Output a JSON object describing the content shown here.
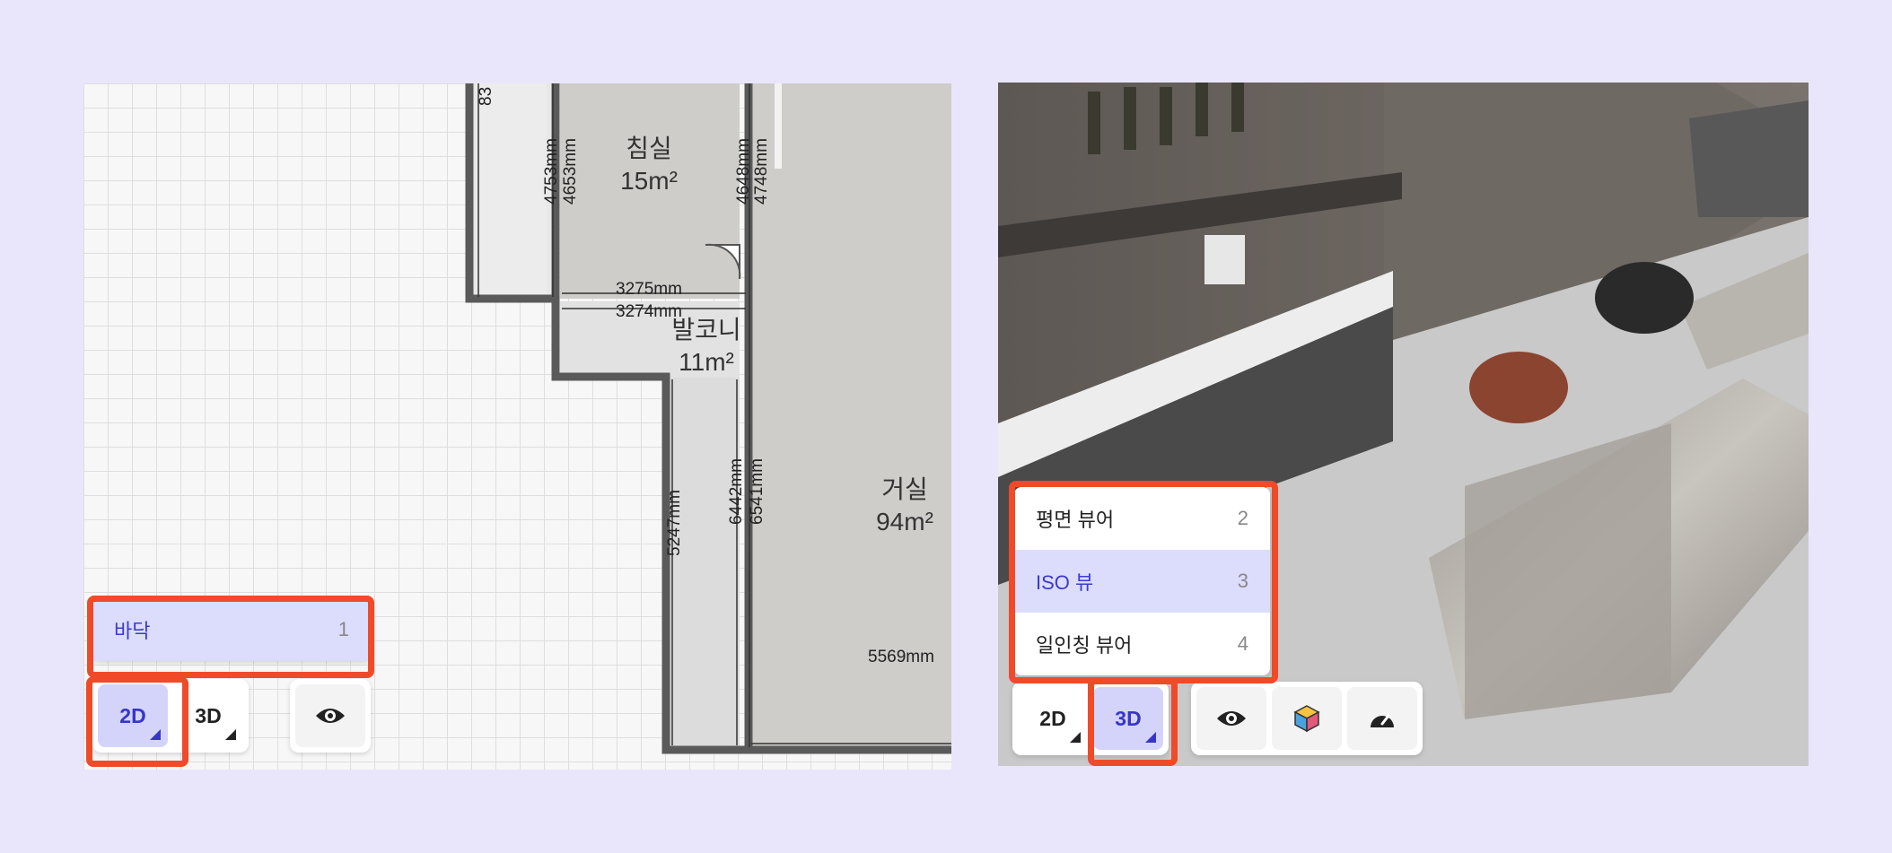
{
  "floorplan": {
    "rooms": [
      {
        "name": "침실",
        "area": "15m²"
      },
      {
        "name": "발코니",
        "area": "11m²"
      },
      {
        "name": "거실",
        "area": "94m²"
      }
    ],
    "dimensions": [
      "83",
      "4753mm",
      "4653mm",
      "4648mm",
      "4748mm",
      "3275mm",
      "3274mm",
      "5247mm",
      "6442mm",
      "6541mm",
      "5569mm"
    ],
    "floor_menu": {
      "label": "바닥",
      "shortcut": "1"
    },
    "toolbar": {
      "btn_2d": "2D",
      "btn_3d": "3D",
      "active": "2D"
    }
  },
  "viewer3d": {
    "view_menu": [
      {
        "label": "평면 뷰어",
        "shortcut": "2",
        "active": false
      },
      {
        "label": "ISO 뷰",
        "shortcut": "3",
        "active": true
      },
      {
        "label": "일인칭 뷰어",
        "shortcut": "4",
        "active": false
      }
    ],
    "toolbar": {
      "btn_2d": "2D",
      "btn_3d": "3D",
      "active": "3D"
    },
    "tool_icons": [
      "eye-icon",
      "cube-icon",
      "gauge-icon"
    ]
  },
  "colors": {
    "highlight": "#f04a28",
    "active_bg": "#d4d4fb",
    "active_text": "#3636c8"
  }
}
